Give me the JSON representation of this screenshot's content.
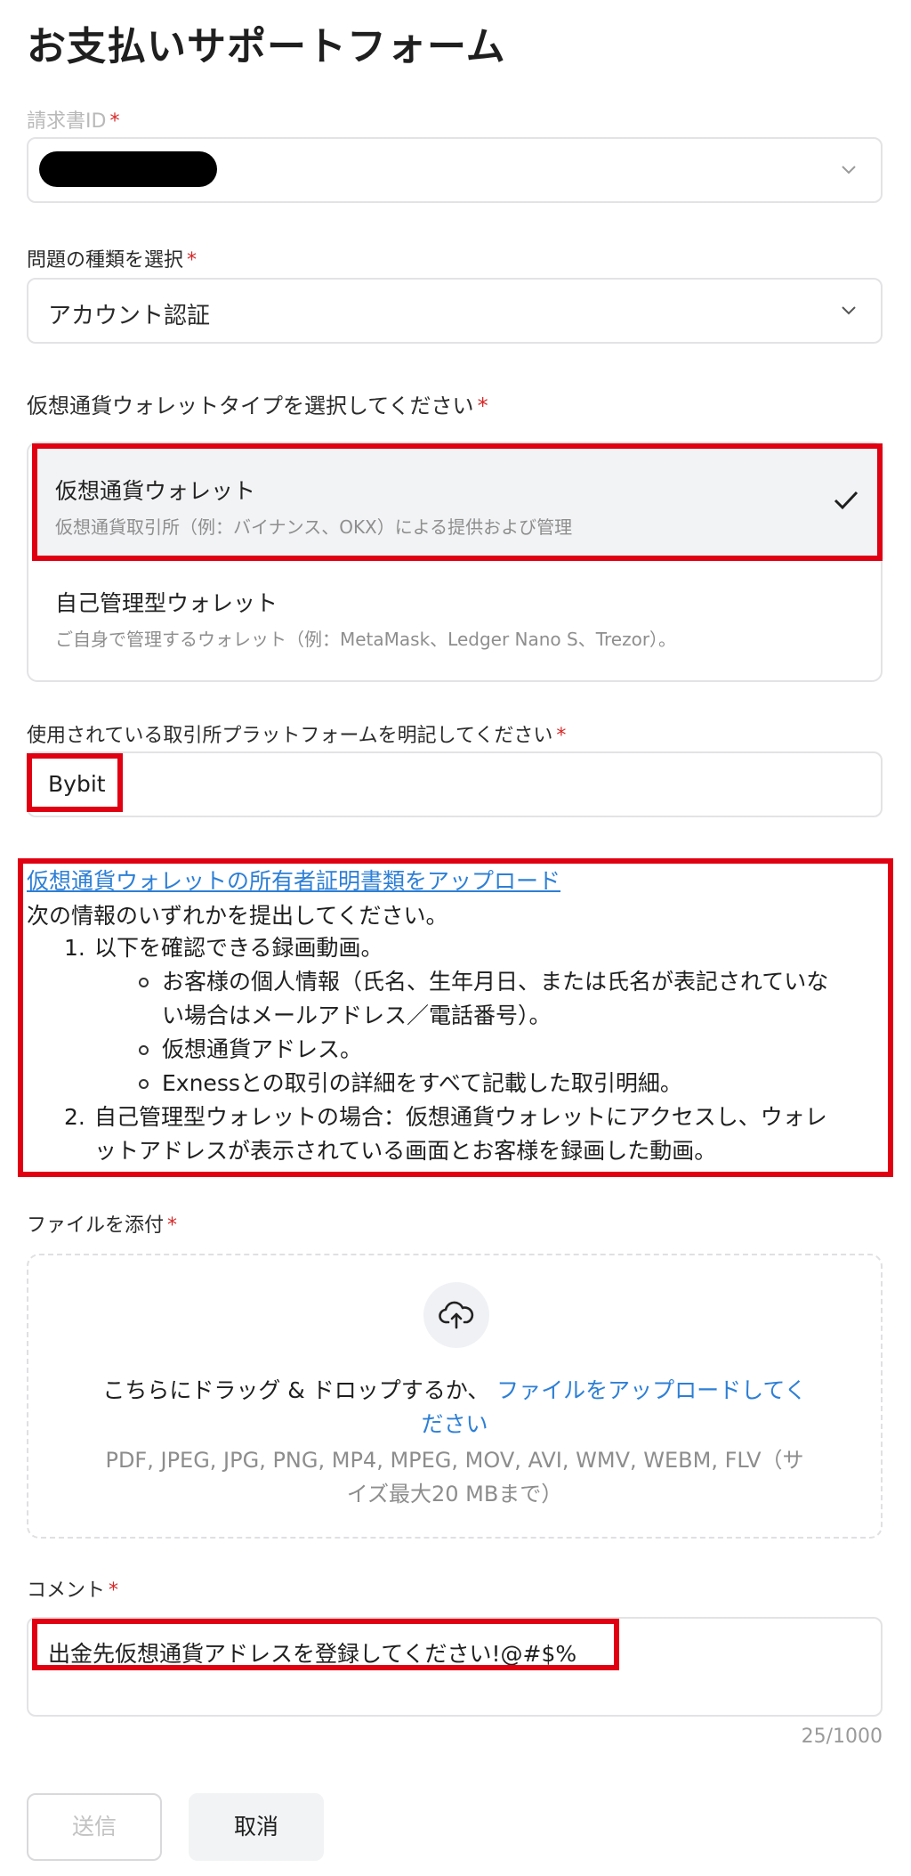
{
  "page": {
    "title": "お支払いサポートフォーム"
  },
  "invoice": {
    "label": "請求書ID",
    "required": "*"
  },
  "issue": {
    "label": "問題の種類を選択",
    "required": "*",
    "value": "アカウント認証"
  },
  "wallet_type": {
    "label": "仮想通貨ウォレットタイプを選択してください",
    "required": "*",
    "options": [
      {
        "name": "仮想通貨ウォレット",
        "desc": "仮想通貨取引所（例：バイナンス、OKX）による提供および管理",
        "selected": true
      },
      {
        "name": "自己管理型ウォレット",
        "desc": "ご自身で管理するウォレット（例：MetaMask、Ledger Nano S、Trezor）。",
        "selected": false
      }
    ]
  },
  "exchange": {
    "label": "使用されている取引所プラットフォームを明記してください",
    "required": "*",
    "value": "Bybit"
  },
  "instructions": {
    "link": "仮想通貨ウォレットの所有者証明書類をアップロード",
    "intro": "次の情報のいずれかを提出してください。",
    "item1_num": "1.",
    "item1": "以下を確認できる録画動画。",
    "sub1_line1": "お客様の個人情報（氏名、生年月日、または氏名が表記されていな",
    "sub1_line2": "い場合はメールアドレス／電話番号）。",
    "sub2": "仮想通貨アドレス。",
    "sub3": "Exnessとの取引の詳細をすべて記載した取引明細。",
    "item2_num": "2.",
    "item2_line1": "自己管理型ウォレットの場合：仮想通貨ウォレットにアクセスし、ウォレ",
    "item2_line2": "ットアドレスが表示されている画面とお客様を録画した動画。"
  },
  "attachment": {
    "label": "ファイルを添付",
    "required": "*",
    "drag_text": "こちらにドラッグ & ドロップするか、",
    "upload_link_1": "ファイルをアップロードしてく",
    "upload_link_2": "ださい",
    "formats_line1": "PDF, JPEG, JPG, PNG, MP4, MPEG, MOV, AVI, WMV, WEBM, FLV（サ",
    "formats_line2": "イズ最大20 MBまで）"
  },
  "comment": {
    "label": "コメント",
    "required": "*",
    "value": "出金先仮想通貨アドレスを登録してください!@#$%",
    "counter": "25/1000"
  },
  "buttons": {
    "submit": "送信",
    "cancel": "取消"
  },
  "colors": {
    "highlight": "#e00012",
    "link": "#2d7fd6",
    "required": "#d62828"
  },
  "icons": [
    "chevron-down-icon",
    "checkmark-icon",
    "cloud-upload-icon"
  ]
}
